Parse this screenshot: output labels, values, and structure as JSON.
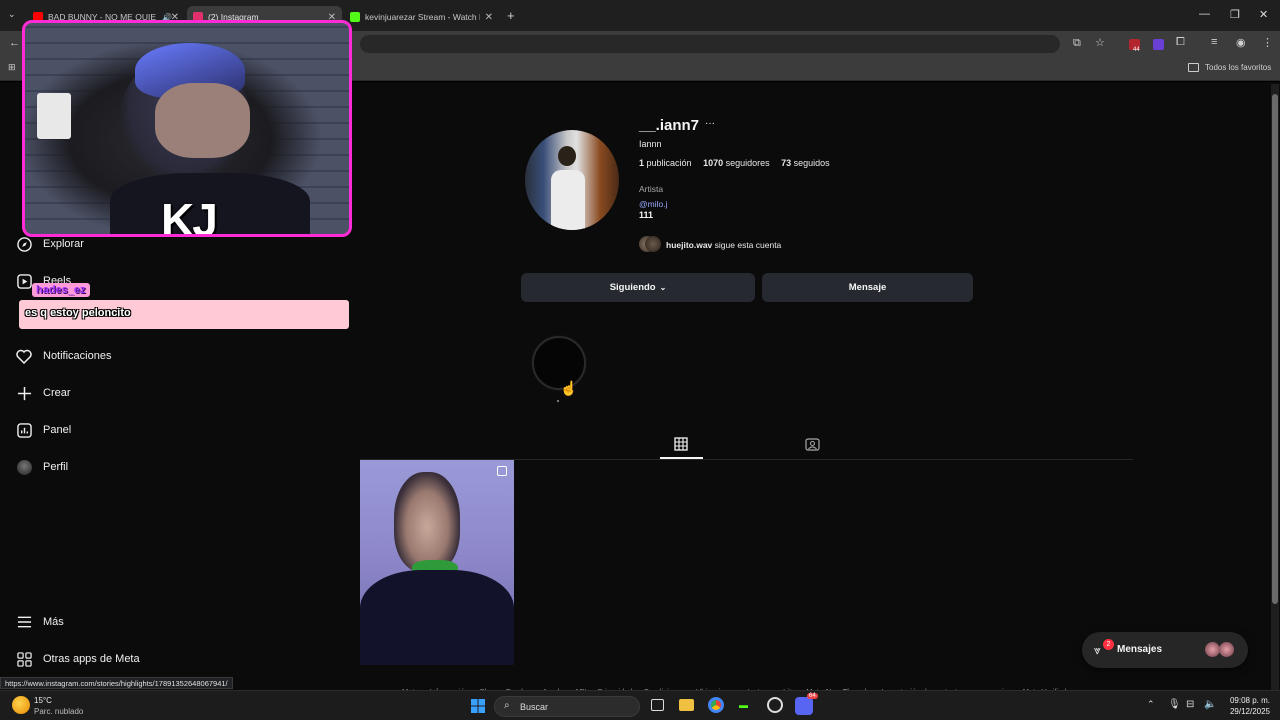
{
  "browser": {
    "tabs": [
      {
        "title": "BAD BUNNY - NO ME QUIE",
        "color": "#ff0000"
      },
      {
        "title": "(2) Instagram",
        "color": "#e1306c"
      },
      {
        "title": "kevinjuarezar Stream - Watch Li",
        "color": "#53fc18"
      }
    ],
    "new_tab": "+",
    "bookmarks_label": "Todos los favoritos",
    "ext_badge": "44",
    "status_url": "https://www.instagram.com/stories/highlights/17891352648067941/"
  },
  "nav": {
    "explore": "Explorar",
    "reels": "Reels",
    "notifications": "Notificaciones",
    "create": "Crear",
    "panel": "Panel",
    "profile": "Perfil",
    "more": "Más",
    "meta_apps": "Otras apps de Meta"
  },
  "profile": {
    "username": "__.iann7",
    "more_glyph": "···",
    "name": "Iannn",
    "posts_count": "1",
    "posts_label": " publicación",
    "followers_count": "1070",
    "followers_label": " seguidores",
    "following_count": "73",
    "following_label": " seguidos",
    "category": "Artista",
    "link": "@milo.j",
    "bio": "111",
    "followed_by_user": "huejito.wav",
    "followed_by_text": " sigue esta cuenta",
    "following_button": "Siguiendo",
    "message_button": "Mensaje"
  },
  "footer_links": [
    "Meta",
    "Información",
    "Blog",
    "Empleo",
    "Ayuda",
    "API",
    "Privacidad",
    "Condiciones",
    "Ubicaciones",
    "Instagram Lite",
    "Meta AI",
    "Threads",
    "Importación de contactos y no usuarios",
    "Meta Verified"
  ],
  "messages": {
    "label": "Mensajes",
    "badge": "2"
  },
  "overlay": {
    "streamer_tag": "KJ",
    "chat_user": "hades_ez",
    "chat_message": "es q estoy peloncito"
  },
  "taskbar": {
    "temperature": "15°C",
    "weather": "Parc. nublado",
    "search_placeholder": "Buscar",
    "time": "09:08 p. m.",
    "date": "29/12/2025",
    "discord_badge": "64"
  },
  "colors": {
    "accent_overlay": "#ff2bd6",
    "link": "#e0f1ff",
    "chat_bg": "#ffc9d6"
  }
}
